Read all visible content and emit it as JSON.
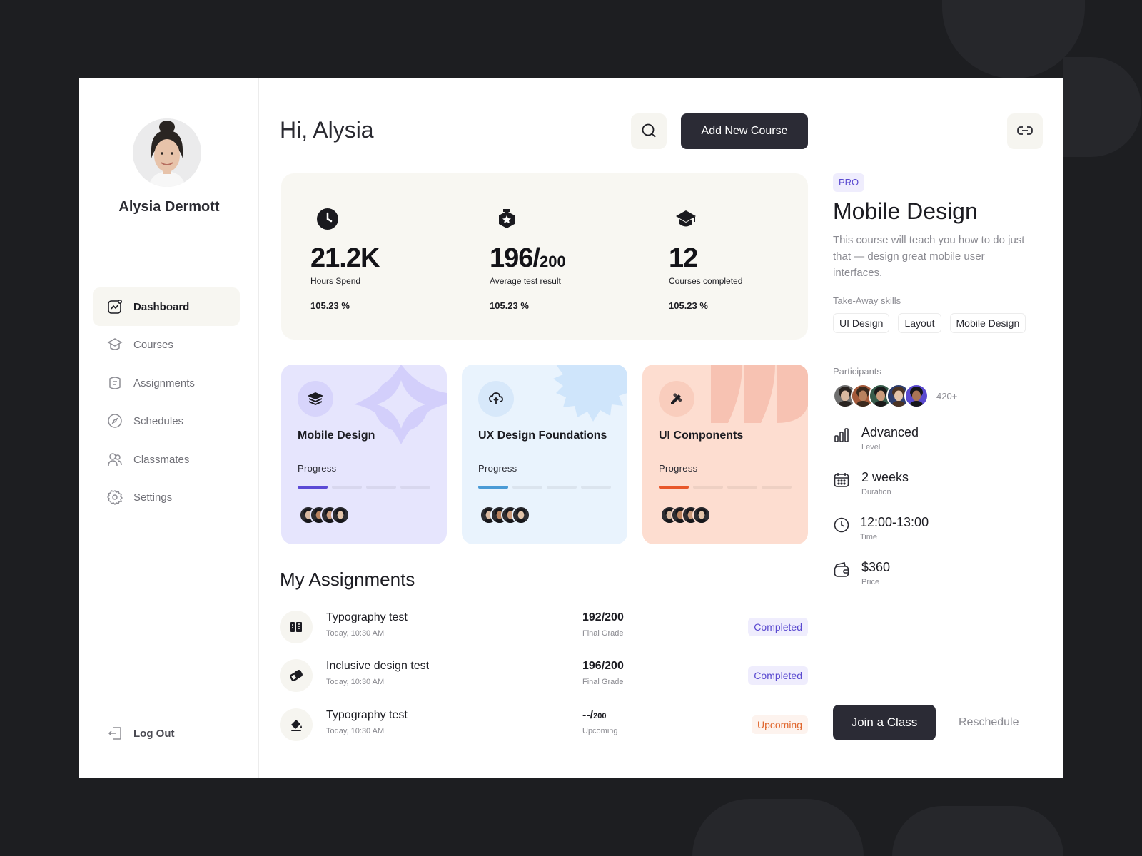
{
  "user": {
    "name": "Alysia Dermott"
  },
  "nav": {
    "items": [
      {
        "label": "Dashboard",
        "icon": "chart-icon",
        "active": true
      },
      {
        "label": "Courses",
        "icon": "graduation-cap-icon"
      },
      {
        "label": "Assignments",
        "icon": "assignment-icon"
      },
      {
        "label": "Schedules",
        "icon": "compass-icon"
      },
      {
        "label": "Classmates",
        "icon": "users-icon"
      },
      {
        "label": "Settings",
        "icon": "gear-icon"
      }
    ],
    "logout": "Log Out"
  },
  "header": {
    "greeting": "Hi, Alysia",
    "add_course": "Add New Course"
  },
  "stats": [
    {
      "icon": "clock-icon",
      "value": "21.2K",
      "value_suffix": "",
      "label": "Hours Spend",
      "percent": "105.23 %"
    },
    {
      "icon": "badge-icon",
      "value": "196/",
      "value_suffix": "200",
      "label": "Average test result",
      "percent": "105.23 %"
    },
    {
      "icon": "cap-icon",
      "value": "12",
      "value_suffix": "",
      "label": "Courses completed",
      "percent": "105.23 %"
    }
  ],
  "courses": [
    {
      "title": "Mobile Design",
      "progress_label": "Progress",
      "progress_segments_filled": 1,
      "progress_segments_total": 4,
      "bg": "#e6e5fd",
      "accent": "#5b4ad6",
      "deco": "#d3cffb",
      "icon": "layers-icon"
    },
    {
      "title": "UX Design Foundations",
      "progress_label": "Progress",
      "progress_segments_filled": 1,
      "progress_segments_total": 4,
      "bg": "#e9f3fd",
      "accent": "#4a9bd6",
      "deco": "#cfe5fb",
      "icon": "upload-cloud-icon"
    },
    {
      "title": "UI Components",
      "progress_label": "Progress",
      "progress_segments_filled": 1,
      "progress_segments_total": 4,
      "bg": "#fdddd0",
      "accent": "#e8572a",
      "deco": "#f7c2b2",
      "icon": "pencil-ruler-icon"
    }
  ],
  "assignments": {
    "title": "My Assignments",
    "rows": [
      {
        "icon": "ruler-icon",
        "name": "Typography test",
        "time": "Today, 10:30 AM",
        "grade": "192/200",
        "grade_suffix": "",
        "grade_label": "Final Grade",
        "status": "Completed",
        "status_type": "done"
      },
      {
        "icon": "link-icon",
        "name": "Inclusive design test",
        "time": "Today, 10:30 AM",
        "grade": "196/200",
        "grade_suffix": "",
        "grade_label": "Final Grade",
        "status": "Completed",
        "status_type": "done"
      },
      {
        "icon": "paint-bucket-icon",
        "name": "Typography test",
        "time": "Today, 10:30 AM",
        "grade": "--/",
        "grade_suffix": "200",
        "grade_label": "Upcoming",
        "status": "Upcoming",
        "status_type": "up"
      }
    ]
  },
  "detail": {
    "badge": "PRO",
    "title": "Mobile Design",
    "description": "This course will teach you how to do just that — design great mobile user interfaces.",
    "skills_label": "Take-Away skills",
    "skills": [
      "UI Design",
      "Layout",
      "Mobile Design"
    ],
    "participants_label": "Participants",
    "participants_count": "420+",
    "info": [
      {
        "icon": "bar-chart-icon",
        "value": "Advanced",
        "label": "Level"
      },
      {
        "icon": "calendar-icon",
        "value": "2 weeks",
        "label": "Duration"
      },
      {
        "icon": "clock-icon",
        "value": "12:00-13:00",
        "label": "Time"
      },
      {
        "icon": "wallet-icon",
        "value": "$360",
        "label": "Price"
      }
    ],
    "join": "Join a Class",
    "reschedule": "Reschedule"
  }
}
